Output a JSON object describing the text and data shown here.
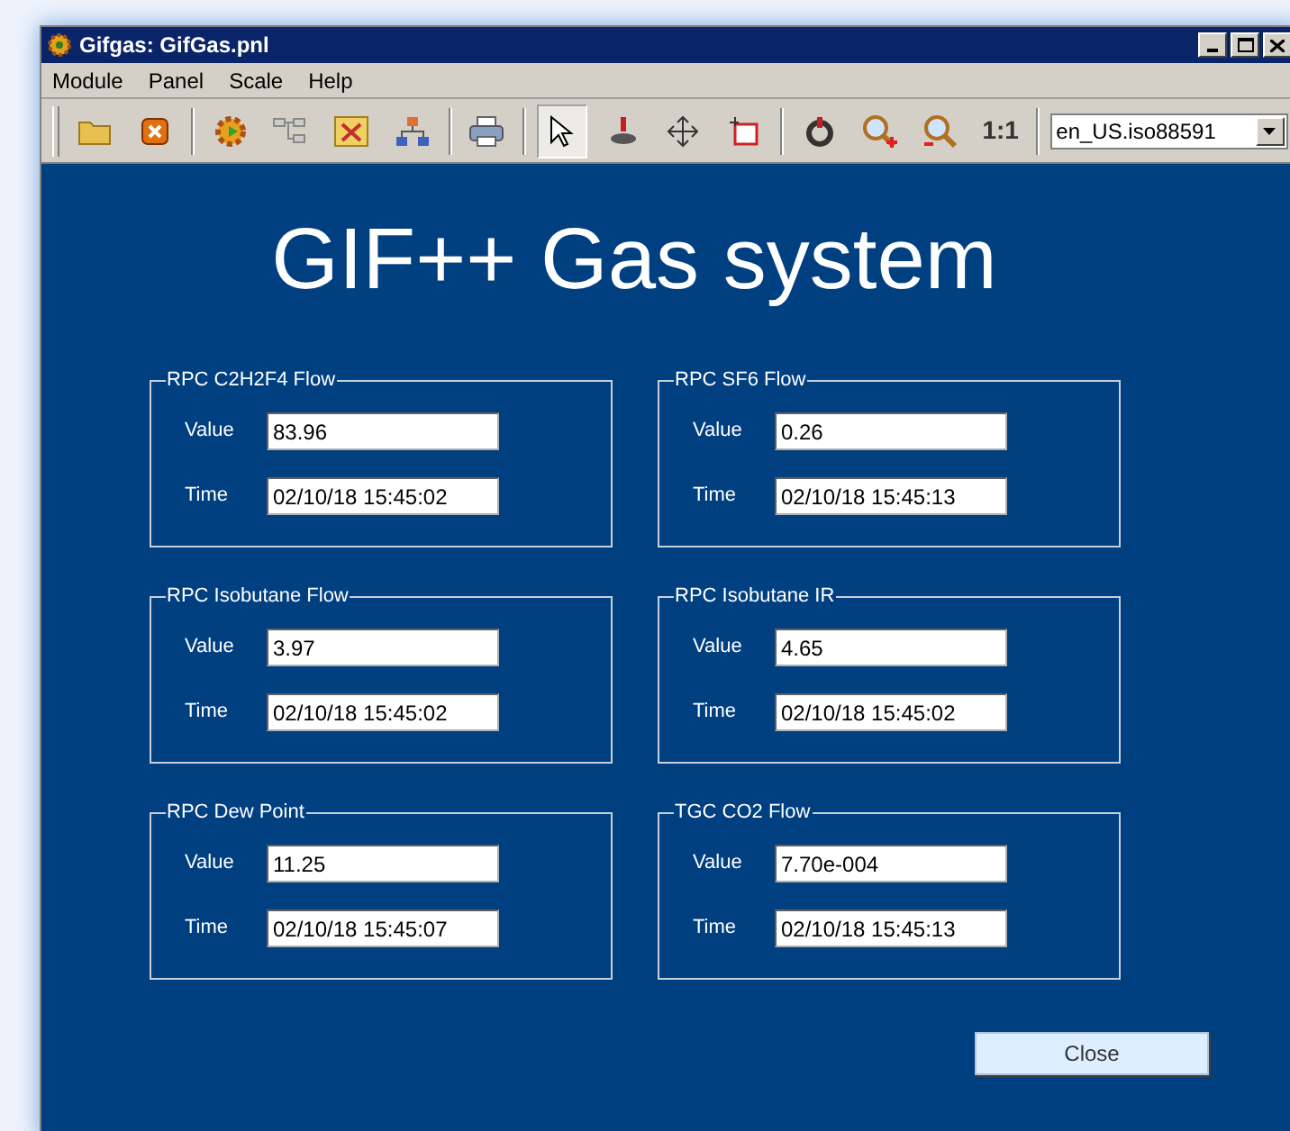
{
  "window": {
    "title": "Gifgas: GifGas.pnl"
  },
  "menu": [
    {
      "label": "Module"
    },
    {
      "label": "Panel"
    },
    {
      "label": "Scale"
    },
    {
      "label": "Help"
    }
  ],
  "tools": [
    {
      "selected": true
    },
    {
      "selected": false
    },
    {
      "selected": false
    },
    {
      "selected": false
    }
  ],
  "zoom_reset": "1:1",
  "locale": {
    "value": "en_US.iso88591"
  },
  "heading": "GIF++ Gas system",
  "groups": [
    {
      "title": "RPC C2H2F4 Flow",
      "value_label": "Value",
      "value": "83.96",
      "time_label": "Time",
      "time": "02/10/18 15:45:02"
    },
    {
      "title": "RPC SF6 Flow",
      "value_label": "Value",
      "value": "0.26",
      "time_label": "Time",
      "time": "02/10/18 15:45:13"
    },
    {
      "title": "RPC Isobutane Flow",
      "value_label": "Value",
      "value": "3.97",
      "time_label": "Time",
      "time": "02/10/18 15:45:02"
    },
    {
      "title": "RPC Isobutane IR",
      "value_label": "Value",
      "value": "4.65",
      "time_label": "Time",
      "time": "02/10/18 15:45:02"
    },
    {
      "title": "RPC Dew Point",
      "value_label": "Value",
      "value": "11.25",
      "time_label": "Time",
      "time": "02/10/18 15:45:07"
    },
    {
      "title": "TGC CO2 Flow",
      "value_label": "Value",
      "value": "7.70e-004",
      "time_label": "Time",
      "time": "02/10/18 15:45:13"
    }
  ],
  "close_button": "Close"
}
